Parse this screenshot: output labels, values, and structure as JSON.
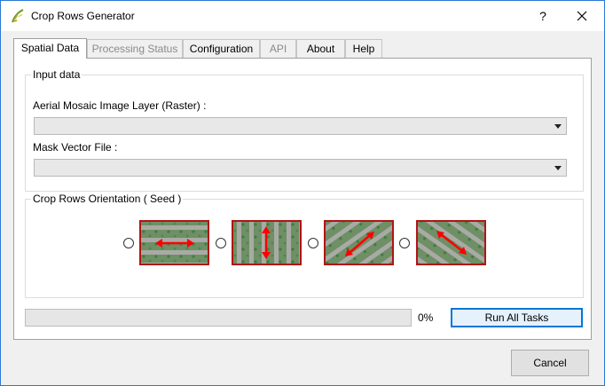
{
  "window": {
    "title": "Crop Rows Generator",
    "help_label": "?"
  },
  "tabs": [
    {
      "label": "Spatial Data",
      "state": "active"
    },
    {
      "label": "Processing Status",
      "state": "disabled"
    },
    {
      "label": "Configuration",
      "state": "normal"
    },
    {
      "label": "API",
      "state": "disabled"
    },
    {
      "label": "About",
      "state": "normal"
    },
    {
      "label": "Help",
      "state": "normal"
    }
  ],
  "input_group": {
    "title": "Input data",
    "raster_label": "Aerial Mosaic Image Layer (Raster) :",
    "raster_value": "",
    "mask_label": "Mask Vector File :",
    "mask_value": ""
  },
  "orientation_group": {
    "title": "Crop Rows Orientation ( Seed )",
    "options": [
      {
        "name": "horizontal",
        "selected": false
      },
      {
        "name": "vertical",
        "selected": false
      },
      {
        "name": "diagonal-up",
        "selected": false
      },
      {
        "name": "diagonal-down",
        "selected": false
      }
    ]
  },
  "progress": {
    "value_percent": 0,
    "text": "0%"
  },
  "buttons": {
    "run_all": "Run All Tasks",
    "cancel": "Cancel"
  },
  "colors": {
    "accent": "#0078d7",
    "seed_border": "#b01515",
    "arrow": "#ff0000",
    "field_green": "#5f8a55"
  }
}
